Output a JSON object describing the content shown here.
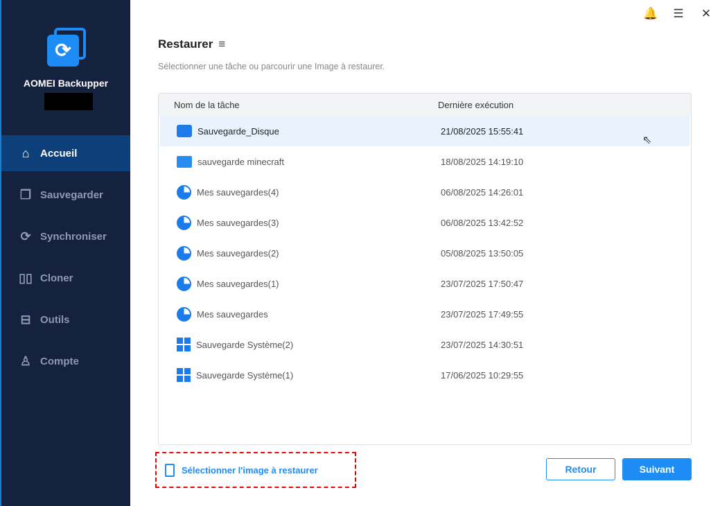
{
  "app": {
    "name": "AOMEI Backupper"
  },
  "sidebar": {
    "items": [
      {
        "label": "Accueil",
        "icon": "home-icon"
      },
      {
        "label": "Sauvegarder",
        "icon": "copy-icon"
      },
      {
        "label": "Synchroniser",
        "icon": "sync-icon"
      },
      {
        "label": "Cloner",
        "icon": "clone-icon"
      },
      {
        "label": "Outils",
        "icon": "toolbox-icon"
      },
      {
        "label": "Compte",
        "icon": "user-icon"
      }
    ]
  },
  "topbar": {
    "bell": "🔔",
    "menu": "☰",
    "close": "✕"
  },
  "page": {
    "title": "Restaurer",
    "filter_icon": "≡",
    "subtitle": "Sélectionner une tâche ou parcourir une Image à restaurer."
  },
  "table": {
    "headers": [
      "Nom de la tâche",
      "Dernière exécution"
    ],
    "rows": [
      {
        "name": "Sauvegarde_Disque",
        "date": "21/08/2025 15:55:41",
        "icon": "disk"
      },
      {
        "name": "sauvegarde minecraft",
        "date": "18/08/2025 14:19:10",
        "icon": "folder"
      },
      {
        "name": "Mes sauvegardes(4)",
        "date": "06/08/2025 14:26:01",
        "icon": "pie"
      },
      {
        "name": "Mes sauvegardes(3)",
        "date": "06/08/2025 13:42:52",
        "icon": "pie"
      },
      {
        "name": "Mes sauvegardes(2)",
        "date": "05/08/2025 13:50:05",
        "icon": "pie"
      },
      {
        "name": "Mes sauvegardes(1)",
        "date": "23/07/2025 17:50:47",
        "icon": "pie"
      },
      {
        "name": "Mes sauvegardes",
        "date": "23/07/2025 17:49:55",
        "icon": "pie"
      },
      {
        "name": "Sauvegarde Système(2)",
        "date": "23/07/2025 14:30:51",
        "icon": "win"
      },
      {
        "name": "Sauvegarde Système(1)",
        "date": "17/06/2025 10:29:55",
        "icon": "win"
      }
    ]
  },
  "footer": {
    "select_image": "Sélectionner l'image à restaurer",
    "back": "Retour",
    "next": "Suivant"
  }
}
